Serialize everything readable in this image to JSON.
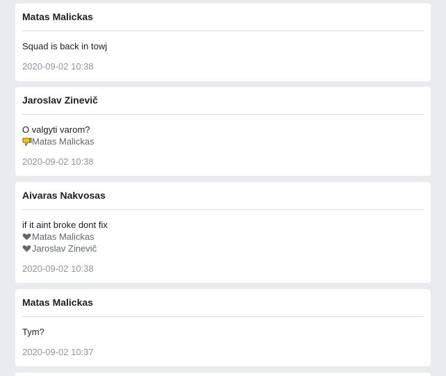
{
  "posts": [
    {
      "author": "Matas Malickas",
      "text": "Squad is back in towj",
      "reactions": [],
      "timestamp": "2020-09-02 10:38"
    },
    {
      "author": "Jaroslav Zinevič",
      "text": "O valgyti varom?",
      "reactions": [
        {
          "icon": "thumbs-down-icon",
          "color": "#f0c419",
          "name": "Matas Malickas"
        }
      ],
      "timestamp": "2020-09-02 10:38"
    },
    {
      "author": "Aivaras Nakvosas",
      "text": "if it aint broke dont fix",
      "reactions": [
        {
          "icon": "heart-icon",
          "color": "#606770",
          "name": "Matas Malickas"
        },
        {
          "icon": "heart-icon",
          "color": "#606770",
          "name": "Jaroslav Zinevič"
        }
      ],
      "timestamp": "2020-09-02 10:38"
    },
    {
      "author": "Matas Malickas",
      "text": "Tym?",
      "reactions": [],
      "timestamp": "2020-09-02 10:37"
    }
  ]
}
